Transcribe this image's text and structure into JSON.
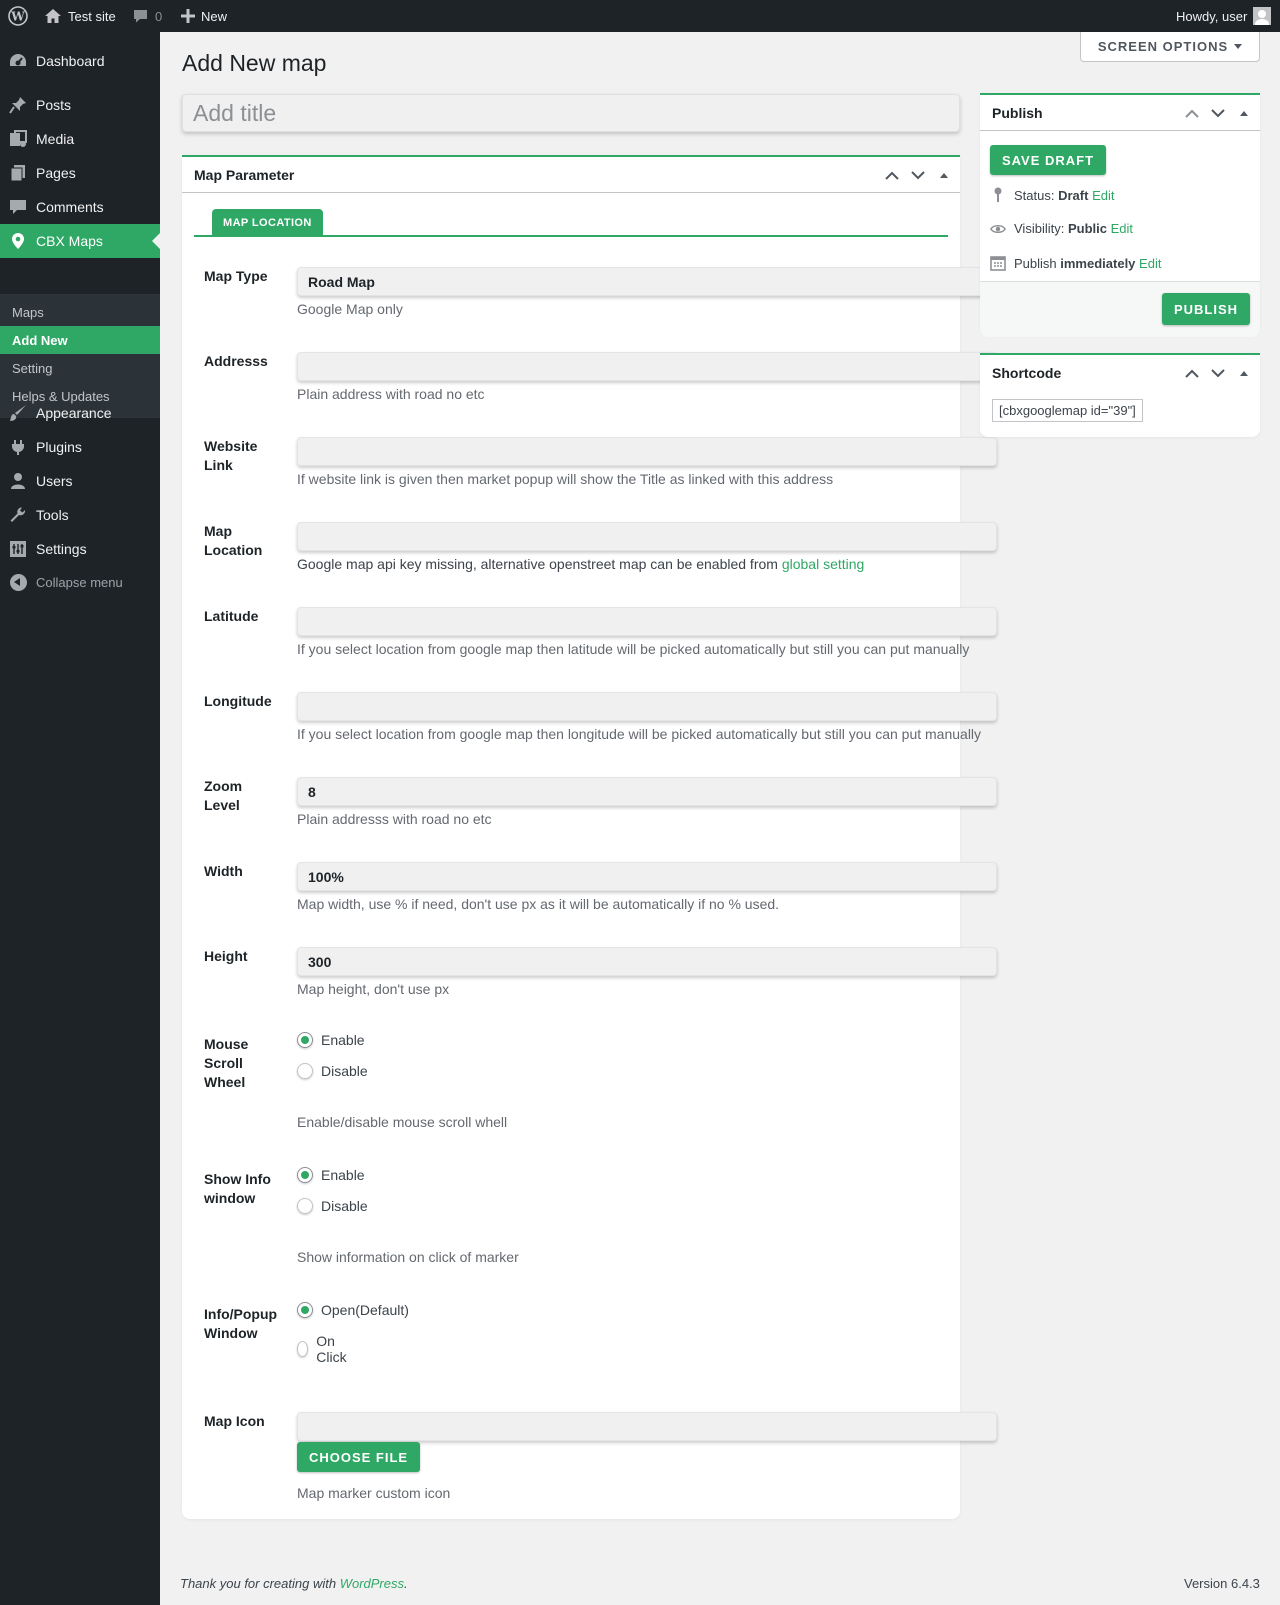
{
  "adminbar": {
    "site_name": "Test site",
    "comments_count": "0",
    "new_label": "New",
    "howdy": "Howdy, user"
  },
  "sidebar": {
    "items": [
      {
        "label": "Dashboard",
        "icon": "dashboard-icon"
      },
      {
        "label": "Posts",
        "icon": "pin-icon"
      },
      {
        "label": "Media",
        "icon": "media-icon"
      },
      {
        "label": "Pages",
        "icon": "pages-icon"
      },
      {
        "label": "Comments",
        "icon": "comments-icon"
      },
      {
        "label": "CBX Maps",
        "icon": "location-icon"
      },
      {
        "label": "Appearance",
        "icon": "brush-icon"
      },
      {
        "label": "Plugins",
        "icon": "plugin-icon"
      },
      {
        "label": "Users",
        "icon": "user-icon"
      },
      {
        "label": "Tools",
        "icon": "wrench-icon"
      },
      {
        "label": "Settings",
        "icon": "settings-icon"
      }
    ],
    "submenu": [
      "Maps",
      "Add New",
      "Setting",
      "Helps & Updates"
    ],
    "collapse_label": "Collapse menu"
  },
  "screen_options_label": "SCREEN OPTIONS",
  "page_title": "Add New map",
  "title_placeholder": "Add title",
  "map_box": {
    "title": "Map Parameter",
    "tab_label": "MAP LOCATION",
    "fields": {
      "map_type": {
        "label": "Map Type",
        "value": "Road Map",
        "desc": "Google Map only"
      },
      "address": {
        "label": "Addresss",
        "value": "",
        "desc": "Plain address with road no etc"
      },
      "website": {
        "label": "Website Link",
        "value": "",
        "desc": "If website link is given then market popup will show the Title as linked with this address"
      },
      "location": {
        "label": "Map Location",
        "value": "",
        "desc": "Google map api key missing, alternative openstreet map can be enabled from ",
        "link": "global setting"
      },
      "latitude": {
        "label": "Latitude",
        "value": "",
        "desc": "If you select location from google map then latitude will be picked automatically but still you can put manually"
      },
      "longitude": {
        "label": "Longitude",
        "value": "",
        "desc": "If you select location from google map then longitude will be picked automatically but still you can put manually"
      },
      "zoom": {
        "label": "Zoom Level",
        "value": "8",
        "desc": "Plain addresss with road no etc"
      },
      "width": {
        "label": "Width",
        "value": "100%",
        "desc": "Map width, use % if need, don't use px as it will be automatically if no % used."
      },
      "height": {
        "label": "Height",
        "value": "300",
        "desc": "Map height, don't use px"
      },
      "scroll": {
        "label": "Mouse Scroll Wheel",
        "opt1": "Enable",
        "opt2": "Disable",
        "desc": "Enable/disable mouse scroll whell"
      },
      "infowin": {
        "label": "Show Info window",
        "opt1": "Enable",
        "opt2": "Disable",
        "desc": "Show information on click of marker"
      },
      "popup": {
        "label": "Info/Popup Window",
        "opt1": "Open(Default)",
        "opt2": "On Click"
      },
      "icon": {
        "label": "Map Icon",
        "value": "",
        "button": "CHOOSE FILE",
        "desc": "Map marker custom icon"
      }
    }
  },
  "publish": {
    "title": "Publish",
    "save_draft": "SAVE DRAFT",
    "status_label": "Status:",
    "status_value": "Draft",
    "visibility_label": "Visibility:",
    "visibility_value": "Public",
    "publish_label": "Publish",
    "publish_value": "immediately",
    "edit": "Edit",
    "publish_button": "PUBLISH"
  },
  "shortcode": {
    "title": "Shortcode",
    "value": "[cbxgooglemap id=\"39\"]"
  },
  "footer": {
    "thanks": "Thank you for creating with ",
    "wp_link": "WordPress",
    "period": ".",
    "version": "Version 6.4.3"
  },
  "colors": {
    "accent": "#2fa866",
    "adminbar": "#1d2327",
    "submenu_bg": "#2c3338",
    "page_bg": "#f1f1f1"
  }
}
